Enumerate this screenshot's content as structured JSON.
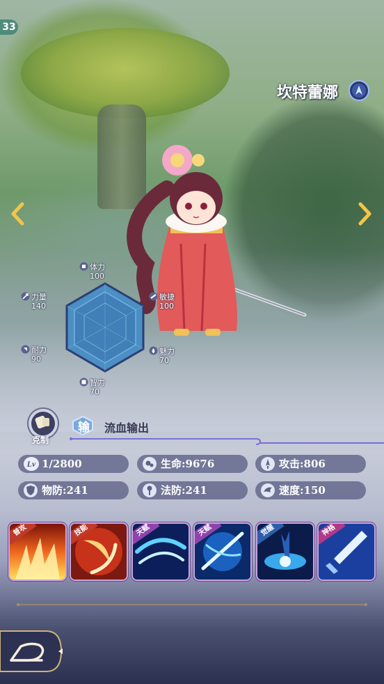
{
  "header": {
    "level": "33",
    "hero_name": "坎特蕾娜"
  },
  "attributes": {
    "stamina": {
      "label": "体力",
      "value": "100"
    },
    "agility": {
      "label": "敏捷",
      "value": "100"
    },
    "charm": {
      "label": "魅力",
      "value": "70"
    },
    "intelligence": {
      "label": "智力",
      "value": "70"
    },
    "endurance": {
      "label": "耐力",
      "value": "90"
    },
    "strength": {
      "label": "力量",
      "value": "140"
    }
  },
  "counter": {
    "label": "克制",
    "type_char": "输",
    "type_text": "流血输出"
  },
  "stats": {
    "level": {
      "icon": "level-icon",
      "text": "1/2800"
    },
    "hp": {
      "icon": "hp-icon",
      "text": "生命:9676"
    },
    "attack": {
      "icon": "attack-icon",
      "text": "攻击:806"
    },
    "phys_def": {
      "icon": "shield-icon",
      "text": "物防:241"
    },
    "magic_def": {
      "icon": "magic-icon",
      "text": "法防:241"
    },
    "speed": {
      "icon": "speed-icon",
      "text": "速度:150"
    }
  },
  "skills": [
    {
      "tag": "普攻",
      "icon": "fire-slash-icon",
      "tag_color": "#c0392b"
    },
    {
      "tag": "技能",
      "icon": "flame-arc-icon",
      "tag_color": "#c0392b"
    },
    {
      "tag": "天赋",
      "icon": "blue-swirl-icon",
      "tag_color": "#8e44ad"
    },
    {
      "tag": "天赋",
      "icon": "blue-slash-icon",
      "tag_color": "#8e44ad"
    },
    {
      "tag": "觉醒",
      "icon": "blue-burst-icon",
      "tag_color": "#2c5fa8"
    },
    {
      "tag": "神格",
      "icon": "blade-icon",
      "tag_color": "#b03a8a"
    }
  ],
  "colors": {
    "accent": "#7b6ed6",
    "pill": "#5c6287",
    "gold": "#f3c54a"
  }
}
